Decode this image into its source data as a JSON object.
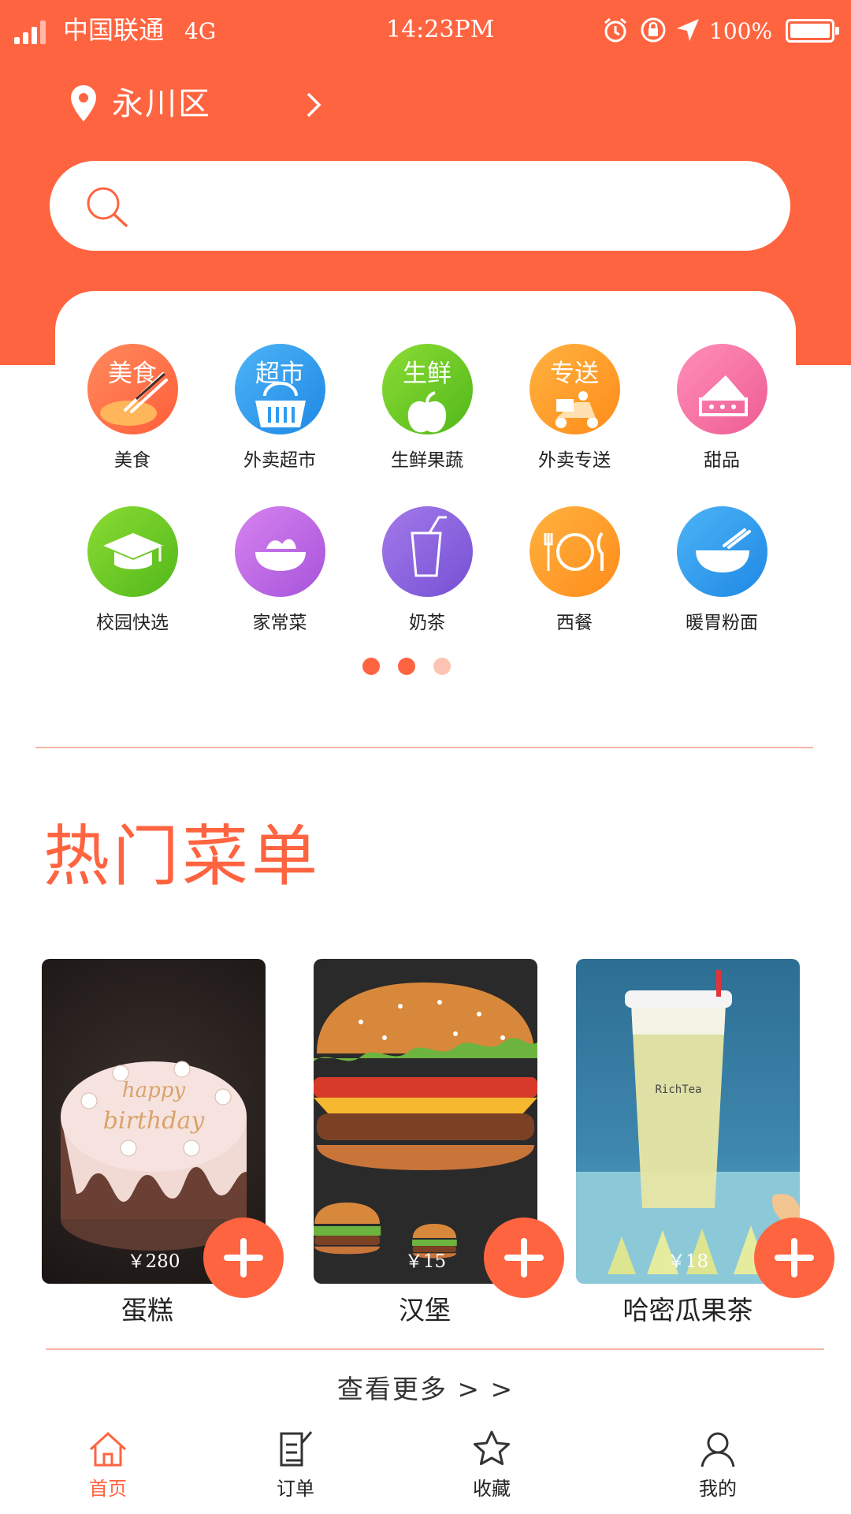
{
  "status_bar": {
    "carrier": "中国联通",
    "network": "4G",
    "time": "14:23PM",
    "battery": "100%",
    "icons": [
      "signal-icon",
      "alarm-icon",
      "rotation-lock-icon",
      "location-arrow-icon",
      "battery-icon"
    ]
  },
  "location": {
    "city": "永川区"
  },
  "search": {
    "placeholder": ""
  },
  "categories": [
    {
      "label": "美食",
      "badge": "美食",
      "icon": "chopsticks-icon",
      "color": "#FF7B52"
    },
    {
      "label": "外卖超市",
      "badge": "超市",
      "icon": "basket-icon",
      "color": "#2E9BF0"
    },
    {
      "label": "生鲜果蔬",
      "badge": "生鲜",
      "icon": "apple-icon",
      "color": "#6CCB1E"
    },
    {
      "label": "外卖专送",
      "badge": "专送",
      "icon": "scooter-icon",
      "color": "#FFA024"
    },
    {
      "label": "甜品",
      "badge": "",
      "icon": "cake-icon",
      "color": "#F470A0"
    },
    {
      "label": "校园快选",
      "badge": "",
      "icon": "graduation-cap-icon",
      "color": "#6CCB1E"
    },
    {
      "label": "家常菜",
      "badge": "",
      "icon": "bowl-dish-icon",
      "color": "#C86BE6"
    },
    {
      "label": "奶茶",
      "badge": "",
      "icon": "cup-icon",
      "color": "#8E62DE"
    },
    {
      "label": "西餐",
      "badge": "",
      "icon": "plate-cutlery-icon",
      "color": "#FFA024"
    },
    {
      "label": "暖胃粉面",
      "badge": "",
      "icon": "noodle-bowl-icon",
      "color": "#2E9BF0"
    }
  ],
  "pagination": {
    "count": 3,
    "active": 1
  },
  "hot_menu": {
    "title": "热门菜单",
    "items": [
      {
        "name": "蛋糕",
        "price": "￥280"
      },
      {
        "name": "汉堡",
        "price": "￥15"
      },
      {
        "name": "哈密瓜果茶",
        "price": "￥18"
      }
    ],
    "more_label": "查看更多 > >"
  },
  "tabbar": [
    {
      "label": "首页",
      "icon": "home-icon",
      "active": true
    },
    {
      "label": "订单",
      "icon": "order-icon",
      "active": false
    },
    {
      "label": "收藏",
      "icon": "star-icon",
      "active": false
    },
    {
      "label": "我的",
      "icon": "user-icon",
      "active": false
    }
  ],
  "colors": {
    "primary": "#FF6440",
    "divider": "#F6B5A5",
    "dot_inactive": "#FDC3B3"
  }
}
